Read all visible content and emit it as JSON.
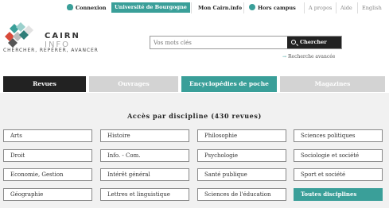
{
  "topbar": {
    "connexion": "Connexion",
    "universite": "Université de Bourgogne",
    "mon_cairn": "Mon Cairn.info",
    "hors_campus": "Hors campus",
    "a_propos": "A propos",
    "aide": "Aide",
    "english": "English"
  },
  "logo": {
    "cairn": "CAIRN",
    "info": "INFO",
    "tagline": "CHERCHER, REPÉRER, AVANCER"
  },
  "search": {
    "placeholder": "Vos mots clés",
    "button": "Chercher",
    "advanced": "Recherche avancée"
  },
  "tabs": [
    {
      "label": "Revues"
    },
    {
      "label": "Ouvrages"
    },
    {
      "label": "Encyclopédies de poche"
    },
    {
      "label": "Magazines"
    }
  ],
  "section": {
    "heading": "Accès par discipline (430 revues)"
  },
  "disciplines": [
    [
      "Arts",
      "Histoire",
      "Philosophie",
      "Sciences politiques"
    ],
    [
      "Droit",
      "Info. - Com.",
      "Psychologie",
      "Sociologie et société"
    ],
    [
      "Economie, Gestion",
      "Intérêt général",
      "Santé publique",
      "Sport et société"
    ],
    [
      "Géographie",
      "Lettres et linguistique",
      "Sciences de l'éducation",
      "Toutes disciplines"
    ]
  ],
  "colors": {
    "accent": "#3a9f99",
    "dark": "#222222",
    "inactive_tab": "#d3d3d3",
    "section_bg": "#f1f1f1"
  }
}
